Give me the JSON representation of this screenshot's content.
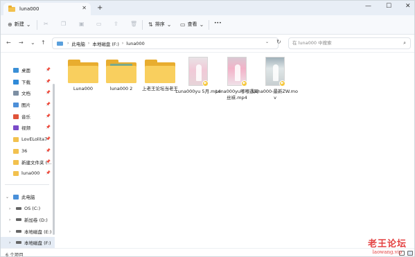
{
  "tab": {
    "label": "luna000",
    "close": "✕"
  },
  "window_controls": {
    "new_tab": "+",
    "minimize": "—",
    "maximize": "☐",
    "close": "✕"
  },
  "toolbar": {
    "new_label": "新建",
    "sort_label": "排序",
    "view_label": "查看",
    "more": "•••"
  },
  "address": {
    "crumbs": [
      "此电脑",
      "本地磁盘 (F:)",
      "luna000"
    ],
    "search_placeholder": "在 luna000 中搜索"
  },
  "sidebar": {
    "quick": [
      {
        "label": "桌面",
        "icon": "desktop-icon",
        "color": "#3a8fd6"
      },
      {
        "label": "下载",
        "icon": "download-icon",
        "color": "#2f8ad8"
      },
      {
        "label": "文档",
        "icon": "document-icon",
        "color": "#7d8fa3"
      },
      {
        "label": "图片",
        "icon": "pictures-icon",
        "color": "#4c8fd8"
      },
      {
        "label": "音乐",
        "icon": "music-icon",
        "color": "#e0533a"
      },
      {
        "label": "视频",
        "icon": "video-icon",
        "color": "#7a4bc8"
      },
      {
        "label": "LovELolita7",
        "icon": "folder-icon",
        "color": "#f2c14e"
      },
      {
        "label": "36",
        "icon": "folder-icon",
        "color": "#f2c14e"
      },
      {
        "label": "新建文件夹 (...",
        "icon": "folder-icon",
        "color": "#f2c14e"
      },
      {
        "label": "luna000",
        "icon": "folder-icon",
        "color": "#f2c14e"
      }
    ],
    "tree": [
      {
        "label": "此电脑",
        "icon": "pc-icon"
      },
      {
        "label": "OS (C:)",
        "icon": "drive-icon"
      },
      {
        "label": "新加卷 (D:)",
        "icon": "drive-icon"
      },
      {
        "label": "本地磁盘 (E:)",
        "icon": "drive-icon"
      },
      {
        "label": "本地磁盘 (F:)",
        "icon": "drive-icon"
      }
    ]
  },
  "files": [
    {
      "name": "Luna000",
      "kind": "folder"
    },
    {
      "name": "luna000 2",
      "kind": "folder-photo"
    },
    {
      "name": "上老王论坛当老王",
      "kind": "folder"
    },
    {
      "name": "Luna000yu 5月.mp4",
      "kind": "video"
    },
    {
      "name": "Luna000yu嘟嘟遇网丝袜.mp4",
      "kind": "video"
    },
    {
      "name": "Luna000-最新ZW.mov",
      "kind": "video"
    }
  ],
  "status": {
    "count": "6 个项目"
  },
  "watermark": {
    "line1": "老王论坛",
    "line2": "laowang.vip"
  }
}
